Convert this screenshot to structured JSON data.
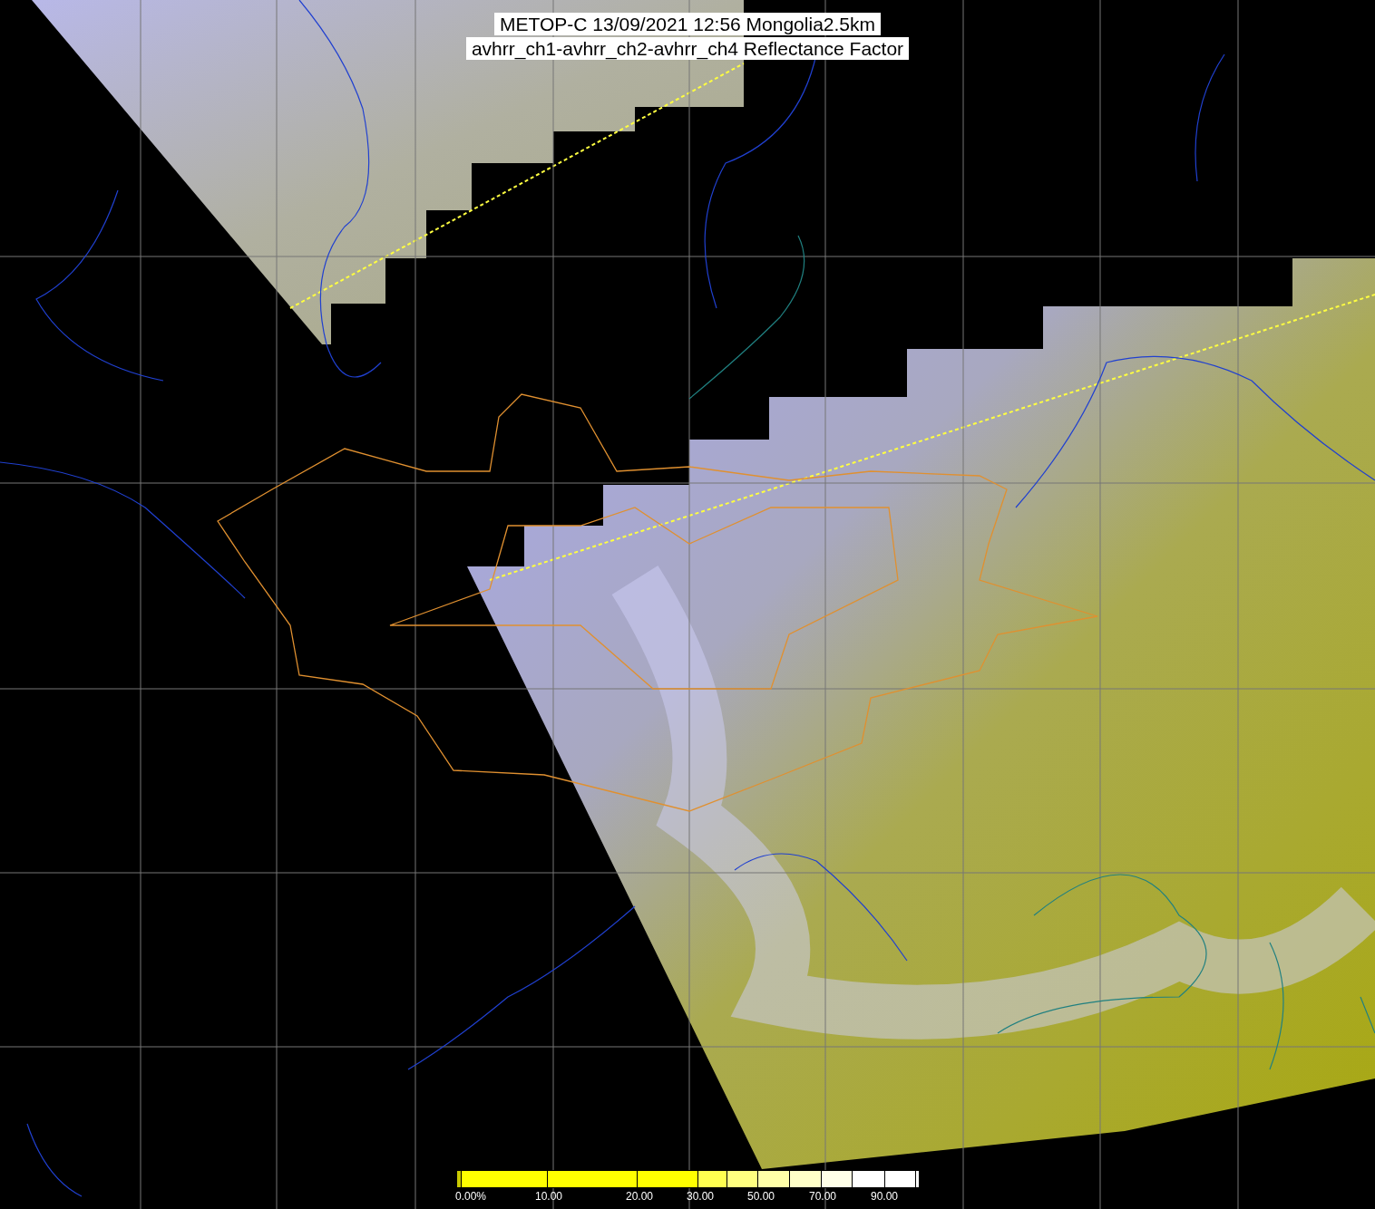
{
  "title": {
    "lines": [
      "METOP-C 13/09/2021 12:56 Mongolia2.5km",
      "avhrr_ch1-avhrr_ch2-avhrr_ch4 Reflectance Factor"
    ]
  },
  "colorbar": {
    "labels": [
      "0.00%",
      "10.00",
      "20.00",
      "30.00",
      "50.00",
      "70.00",
      "90.00"
    ]
  }
}
